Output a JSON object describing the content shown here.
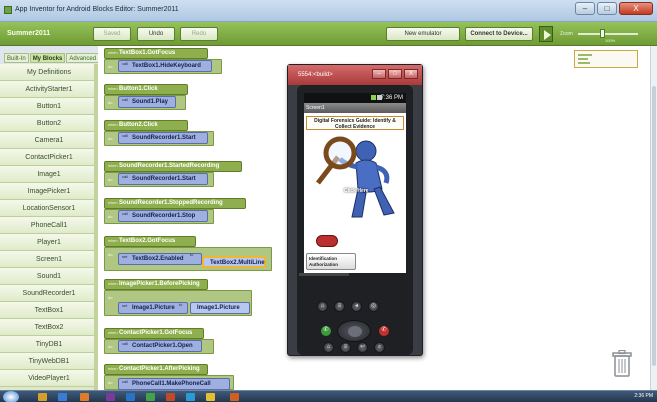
{
  "window": {
    "title": "App Inventor for Android Blocks Editor: Summer2011",
    "min": "–",
    "max": "□",
    "close": "X"
  },
  "header": {
    "project": "Summer2011",
    "saved": "Saved",
    "undo": "Undo",
    "redo": "Redo",
    "new_emulator": "New emulator",
    "connect": "Connect to Device...",
    "zoom_label": "Zoom",
    "zoom_value_label": "100%",
    "zoom_level_pct": 40
  },
  "drawer": {
    "tabs": [
      "Built-In",
      "My Blocks",
      "Advanced"
    ],
    "selected_tab": "My Blocks",
    "items": [
      "My Definitions",
      "ActivityStarter1",
      "Button1",
      "Button2",
      "Camera1",
      "ContactPicker1",
      "Image1",
      "ImagePicker1",
      "LocationSensor1",
      "PhoneCall1",
      "Player1",
      "Screen1",
      "Sound1",
      "SoundRecorder1",
      "TextBox1",
      "TextBox2",
      "TinyDB1",
      "TinyWebDB1",
      "VideoPlayer1"
    ]
  },
  "blocks": {
    "when": "when",
    "do": "do",
    "call": "call",
    "set": "set",
    "to": "to",
    "b1": {
      "event": "TextBox1.GotFocus",
      "call": "TextBox1.HideKeyboard"
    },
    "b2": {
      "event": "Button1.Click",
      "call": "Sound1.Play"
    },
    "b3": {
      "event": "Button2.Click",
      "call": "SoundRecorder1.Start"
    },
    "b4": {
      "event": "SoundRecorder1.StartedRecording",
      "call": "SoundRecorder1.Start"
    },
    "b5": {
      "event": "SoundRecorder1.StoppedRecording",
      "call": "SoundRecorder1.Stop"
    },
    "b6": {
      "event": "TextBox2.GotFocus",
      "setter": "TextBox2.Enabled",
      "getter": "TextBox2.MultiLine"
    },
    "b7": {
      "event": "ImagePicker1.BeforePicking",
      "setter": "Image1.Picture",
      "getter": "Image1.Picture"
    },
    "b8": {
      "event": "ContactPicker1.GotFocus",
      "call": "ContactPicker1.Open"
    },
    "b9": {
      "event": "ContactPicker1.AfterPicking",
      "call": "PhoneCall1.MakePhoneCall"
    }
  },
  "emulator": {
    "title": "5554:<build>",
    "time": "7:36 PM",
    "screen_name": "Screen1",
    "guide": "Digital Forensics Guide: Identify & Collect Evidence",
    "click_here": "Click Here",
    "id_button": "Identification Authorization"
  },
  "taskbar": {
    "time": "2:36 PM"
  }
}
